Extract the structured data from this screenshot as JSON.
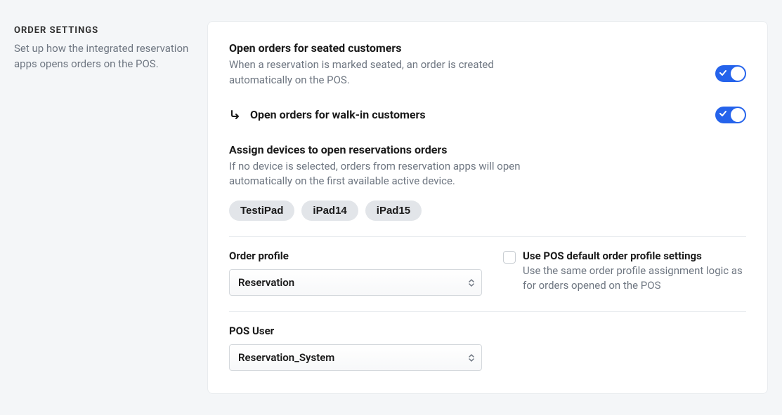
{
  "sidebar": {
    "title": "ORDER SETTINGS",
    "description": "Set up how the integrated reservation apps opens orders on the POS."
  },
  "seated": {
    "title": "Open orders for seated customers",
    "description": "When a reservation is marked seated, an order is created automatically on the POS.",
    "enabled": true
  },
  "walkin": {
    "title": "Open orders for walk-in customers",
    "enabled": true
  },
  "assign": {
    "title": "Assign devices to open reservations orders",
    "description": "If no device is selected, orders from reservation apps will open automatically on the first available active device.",
    "devices": [
      "TestiPad",
      "iPad14",
      "iPad15"
    ]
  },
  "orderProfile": {
    "label": "Order profile",
    "selected": "Reservation",
    "useDefault": {
      "checked": false,
      "title": "Use POS default order profile settings",
      "description": "Use the same order profile assignment logic as for orders opened on the POS"
    }
  },
  "posUser": {
    "label": "POS User",
    "selected": "Reservation_System"
  }
}
